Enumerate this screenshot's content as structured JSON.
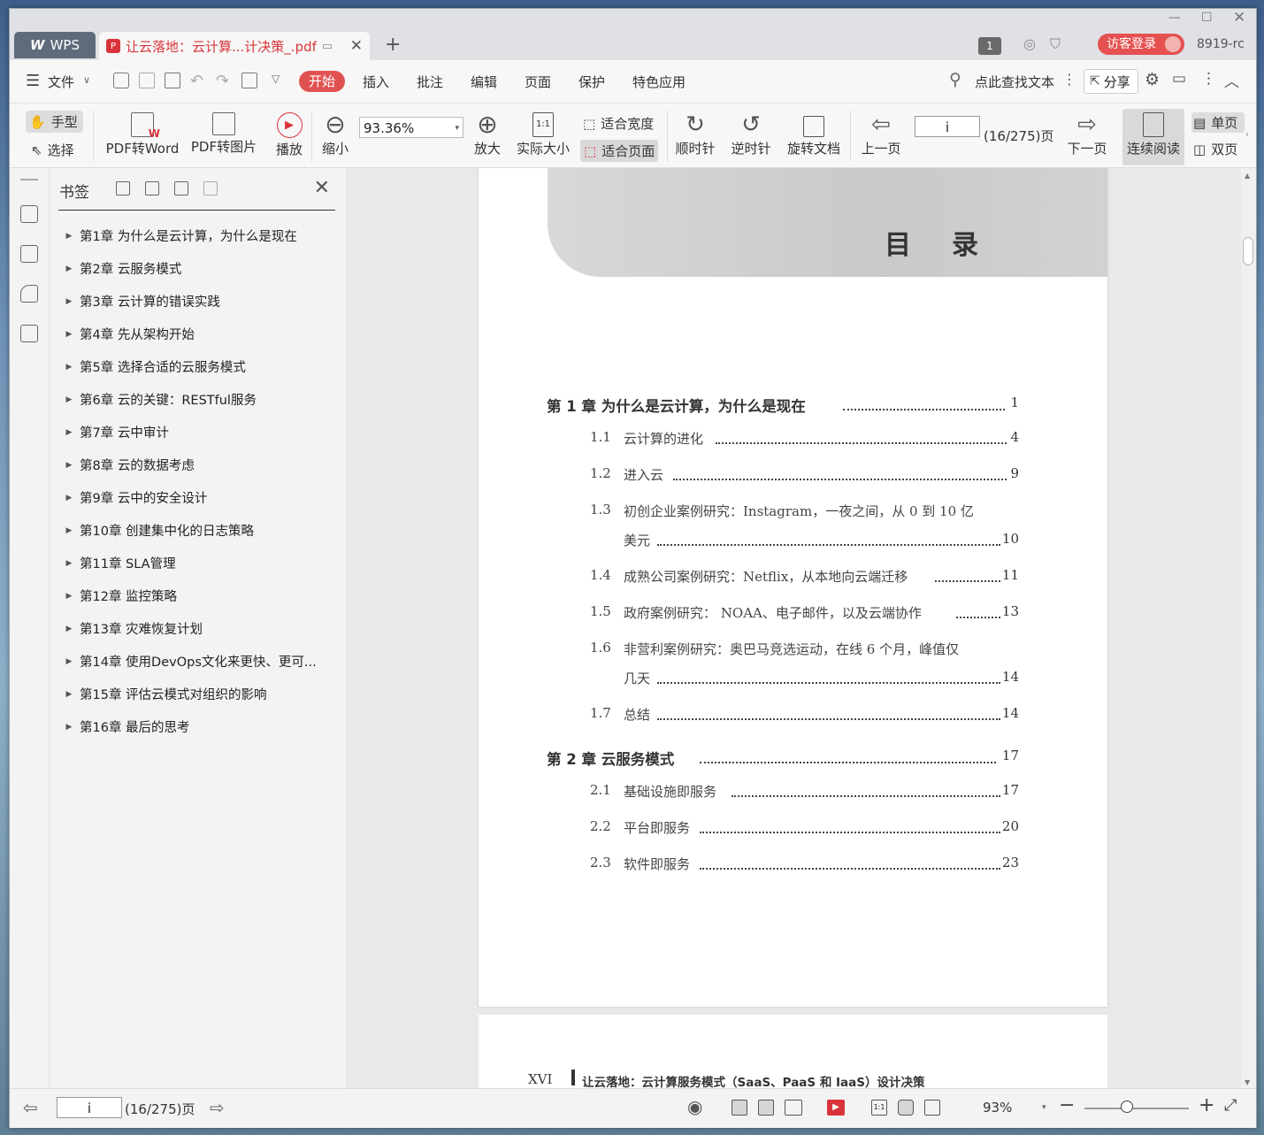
{
  "app": {
    "wps_tab_label": "WPS",
    "doc_tab_label": "让云落地：云计算...计决策_.pdf"
  },
  "titlebar": {
    "badge": "1",
    "login": "访客登录",
    "user_code": "8919-rc"
  },
  "menu": {
    "file": "文件",
    "tabs": [
      "开始",
      "插入",
      "批注",
      "编辑",
      "页面",
      "保护",
      "特色应用"
    ],
    "search": "点此查找文本",
    "share": "分享"
  },
  "toolbar": {
    "hand": "手型",
    "select": "选择",
    "pdf_to_word": "PDF转Word",
    "pdf_to_image": "PDF转图片",
    "play": "播放",
    "zoom_out": "缩小",
    "zoom_value": "93.36%",
    "zoom_in": "放大",
    "actual_size": "实际大小",
    "fit_width": "适合宽度",
    "fit_page": "适合页面",
    "clockwise": "顺时针",
    "counter_clockwise": "逆时针",
    "rotate_doc": "旋转文档",
    "prev_page": "上一页",
    "page_value": "i",
    "page_count": "(16/275)页",
    "next_page": "下一页",
    "continuous": "连续阅读",
    "single": "单页",
    "double": "双页"
  },
  "bookmarks": {
    "title": "书签",
    "items": [
      "第1章  为什么是云计算，为什么是现在",
      "第2章  云服务模式",
      "第3章  云计算的错误实践",
      "第4章  先从架构开始",
      "第5章  选择合适的云服务模式",
      "第6章  云的关键：RESTful服务",
      "第7章  云中审计",
      "第8章  云的数据考虑",
      "第9章  云中的安全设计",
      "第10章  创建集中化的日志策略",
      "第11章  SLA管理",
      "第12章  监控策略",
      "第13章  灾难恢复计划",
      "第14章  使用DevOps文化来更快、更可...",
      "第15章  评估云模式对组织的影响",
      "第16章  最后的思考"
    ]
  },
  "document": {
    "heading": "目录",
    "toc": {
      "ch1": {
        "title": "第 1 章    为什么是云计算，为什么是现在",
        "page": "1"
      },
      "s11": {
        "num": "1.1",
        "title": "云计算的进化",
        "page": "4"
      },
      "s12": {
        "num": "1.2",
        "title": "进入云",
        "page": "9"
      },
      "s13": {
        "num": "1.3",
        "title": "初创企业案例研究：Instagram，一夜之间，从 0 到 10 亿",
        "title2": "美元",
        "page": "10"
      },
      "s14": {
        "num": "1.4",
        "title": "成熟公司案例研究：Netflix，从本地向云端迁移",
        "page": "11"
      },
      "s15": {
        "num": "1.5",
        "title": "政府案例研究： NOAA、电子邮件，以及云端协作",
        "page": "13"
      },
      "s16": {
        "num": "1.6",
        "title": "非营利案例研究：奥巴马竞选运动，在线 6 个月，峰值仅",
        "title2": "几天",
        "page": "14"
      },
      "s17": {
        "num": "1.7",
        "title": "总结",
        "page": "14"
      },
      "ch2": {
        "title": "第 2 章    云服务模式",
        "page": "17"
      },
      "s21": {
        "num": "2.1",
        "title": "基础设施即服务",
        "page": "17"
      },
      "s22": {
        "num": "2.2",
        "title": "平台即服务",
        "page": "20"
      },
      "s23": {
        "num": "2.3",
        "title": "软件即服务",
        "page": "23"
      }
    },
    "footer_page": "XVI",
    "footer_title": "让云落地：云计算服务模式（SaaS、PaaS 和 IaaS）设计决策"
  },
  "statusbar": {
    "page_value": "i",
    "page_count": "(16/275)页",
    "zoom": "93%",
    "zoom_fraction": 0.41
  }
}
